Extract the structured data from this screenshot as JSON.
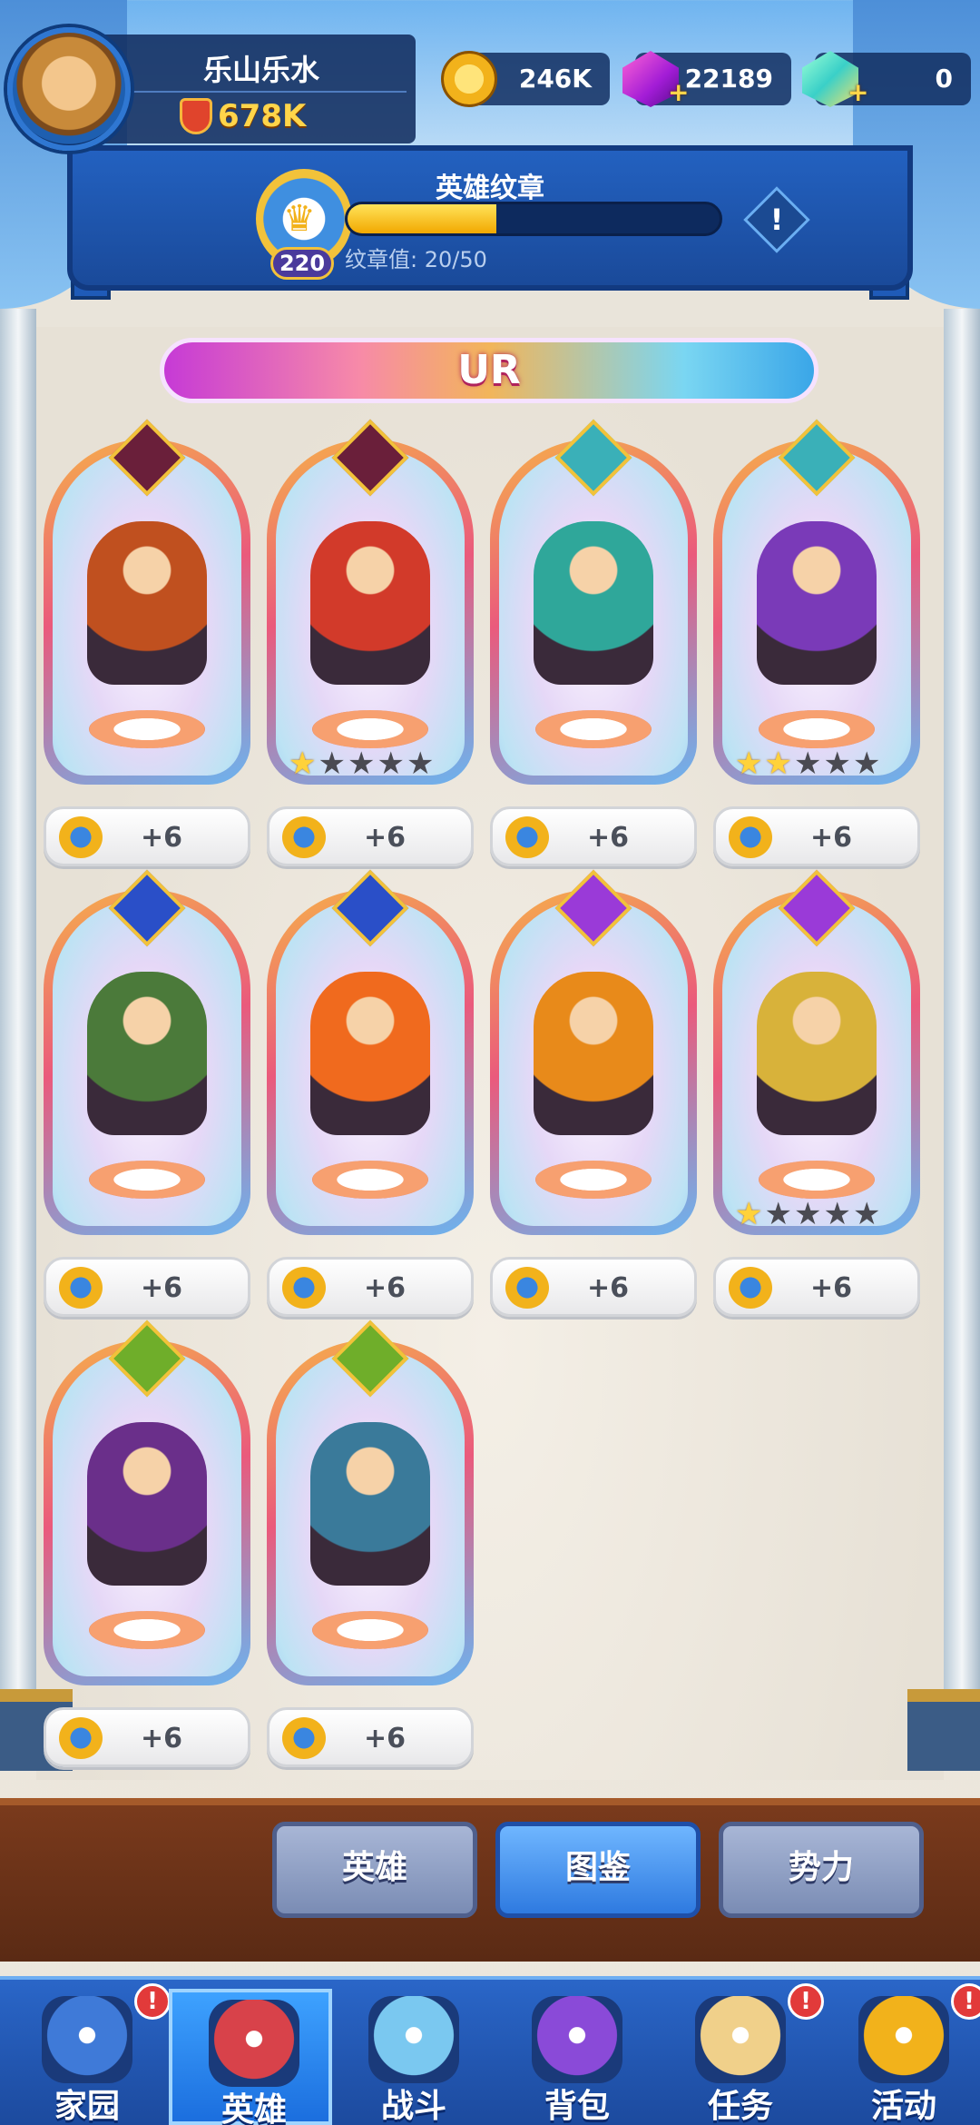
{
  "player": {
    "name": "乐山乐水",
    "power": "678K"
  },
  "currencies": [
    {
      "icon": "gold-coin-icon",
      "value": "246K"
    },
    {
      "icon": "purple-gem-icon",
      "value": "22189"
    },
    {
      "icon": "rainbow-crystal-icon",
      "value": "0"
    }
  ],
  "emblem": {
    "title": "英雄纹章",
    "level": "220",
    "value_text": "纹章值: 20/50",
    "progress": 0.4,
    "info_label": "!"
  },
  "rarity_label": "UR",
  "heroes": [
    {
      "name": "horned-demon-hero",
      "faction": "dark",
      "faction_glyph": "",
      "stars": 0,
      "bonus": "+6",
      "color": "#c0501f"
    },
    {
      "name": "red-orc-warrior-hero",
      "faction": "dark",
      "faction_glyph": "",
      "stars": 1,
      "bonus": "+6",
      "color": "#d23a2a"
    },
    {
      "name": "jade-masked-hero",
      "faction": "order",
      "faction_glyph": "",
      "stars": 0,
      "bonus": "+6",
      "color": "#2fa79a"
    },
    {
      "name": "violet-knight-hero",
      "faction": "order",
      "faction_glyph": "",
      "stars": 2,
      "bonus": "+6",
      "color": "#7a3ab8"
    },
    {
      "name": "medusa-archer-hero",
      "faction": "arcane",
      "faction_glyph": "",
      "stars": 0,
      "bonus": "+6",
      "color": "#4b7a3a"
    },
    {
      "name": "phoenix-spirit-hero",
      "faction": "arcane",
      "faction_glyph": "",
      "stars": 0,
      "bonus": "+6",
      "color": "#f06a1e"
    },
    {
      "name": "golden-flame-knight-hero",
      "faction": "light",
      "faction_glyph": "",
      "stars": 0,
      "bonus": "+6",
      "color": "#e88a1a"
    },
    {
      "name": "winged-paladin-hero",
      "faction": "light",
      "faction_glyph": "",
      "stars": 1,
      "bonus": "+6",
      "color": "#d8b23a"
    },
    {
      "name": "beast-rider-druid-hero",
      "faction": "nature",
      "faction_glyph": "",
      "stars": 0,
      "bonus": "+6",
      "color": "#6a2f8a"
    },
    {
      "name": "treant-dragon-hero",
      "faction": "nature",
      "faction_glyph": "",
      "stars": 0,
      "bonus": "+6",
      "color": "#3a7a9a"
    }
  ],
  "faction_colors": {
    "dark": "#6a1f3a",
    "order": "#3ab0b8",
    "arcane": "#2a4fc8",
    "light": "#9a3ad8",
    "nature": "#6fae2a"
  },
  "subtabs": [
    {
      "label": "英雄",
      "active": false
    },
    {
      "label": "图鉴",
      "active": true
    },
    {
      "label": "势力",
      "active": false
    }
  ],
  "nav": [
    {
      "label": "家园",
      "icon": "home-icon",
      "alert": true,
      "active": false,
      "color": "#3f7ad8"
    },
    {
      "label": "英雄",
      "icon": "hero-icon",
      "alert": false,
      "active": true,
      "color": "#d8424a"
    },
    {
      "label": "战斗",
      "icon": "crossed-swords-icon",
      "alert": false,
      "active": false,
      "color": "#7ac8f0"
    },
    {
      "label": "背包",
      "icon": "backpack-icon",
      "alert": false,
      "active": false,
      "color": "#8a4ad8"
    },
    {
      "label": "任务",
      "icon": "scroll-icon",
      "alert": true,
      "active": false,
      "color": "#f0d08a"
    },
    {
      "label": "活动",
      "icon": "laurel-crown-icon",
      "alert": true,
      "active": false,
      "color": "#f2b21b"
    }
  ]
}
